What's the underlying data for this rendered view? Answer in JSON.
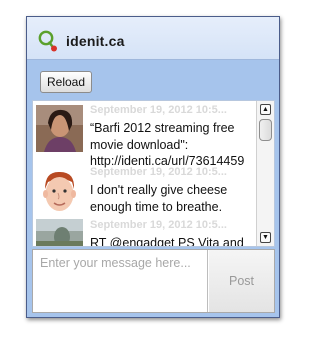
{
  "app": {
    "title": "idenit.ca",
    "logo_icon": "speech-bubble-logo-icon",
    "accent_color": "#a6c4ec"
  },
  "toolbar": {
    "reload_label": "Reload"
  },
  "feed": {
    "items": [
      {
        "timestamp": "September 19, 2012 10:5...",
        "lines": [
          "“Barfi 2012 streaming free",
          "movie download\":",
          "http://identi.ca/url/73614459"
        ],
        "avatar": "woman-portrait"
      },
      {
        "timestamp": "September 19, 2012 10:5...",
        "lines": [
          "I don't really give cheese",
          "enough time to breathe."
        ],
        "avatar": "cartoon-face"
      },
      {
        "timestamp": "September 19, 2012 10:5...",
        "lines": [
          "RT @engadget PS Vita and"
        ],
        "avatar": "outdoor-photo"
      }
    ]
  },
  "scrollbar": {
    "up_icon": "▲",
    "down_icon": "▼"
  },
  "composer": {
    "placeholder": "Enter your message here...",
    "post_label": "Post"
  }
}
